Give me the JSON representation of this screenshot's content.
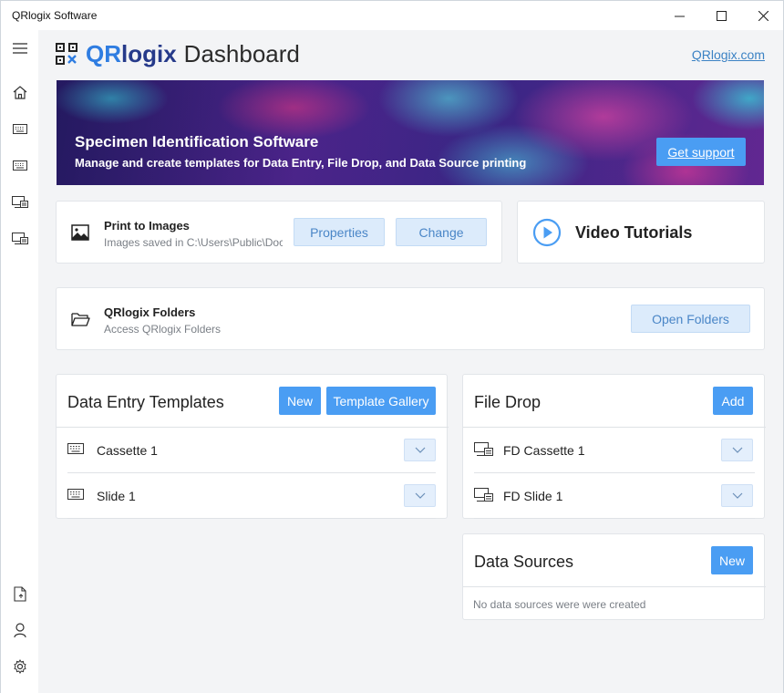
{
  "window": {
    "title": "QRlogix Software"
  },
  "header": {
    "brand_qr": "QR",
    "brand_logix": "logix",
    "brand_dashboard": "Dashboard",
    "site_link": "QRlogix.com"
  },
  "banner": {
    "title": "Specimen Identification Software",
    "subtitle": "Manage and create templates for Data Entry, File Drop, and Data Source printing",
    "button": "Get support"
  },
  "printer": {
    "title": "Print to Images",
    "path": "Images saved in C:\\Users\\Public\\Documents\\QRlogix",
    "properties_button": "Properties",
    "change_button": "Change"
  },
  "tutorials": {
    "title": "Video Tutorials"
  },
  "folders": {
    "title": "QRlogix Folders",
    "subtitle": "Access QRlogix Folders",
    "button": "Open Folders"
  },
  "data_entry": {
    "title": "Data Entry Templates",
    "new_button": "New",
    "gallery_button": "Template Gallery",
    "items": [
      {
        "label": "Cassette 1"
      },
      {
        "label": "Slide 1"
      }
    ]
  },
  "file_drop": {
    "title": "File Drop",
    "add_button": "Add",
    "items": [
      {
        "label": "FD Cassette 1"
      },
      {
        "label": "FD Slide 1"
      }
    ]
  },
  "data_sources": {
    "title": "Data Sources",
    "new_button": "New",
    "empty_text": "No data sources were were created"
  },
  "icons": {
    "sidebar": [
      "menu-icon",
      "home-icon",
      "keyboard-icon",
      "keyboard-icon",
      "file-drop-icon",
      "file-drop-icon",
      "export-file-icon",
      "user-icon",
      "gear-icon"
    ]
  },
  "colors": {
    "accent": "#4a9df3",
    "brand_qr": "#2f7de1",
    "brand_logix": "#263a8a",
    "background": "#f3f4f6"
  }
}
